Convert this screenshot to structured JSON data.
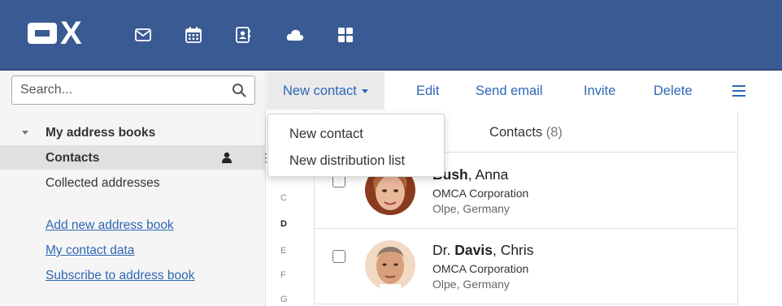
{
  "brand": {
    "logo_text": "OX",
    "topbar_color": "#3a5a93",
    "accent": "#2e67b5"
  },
  "apps": [
    {
      "name": "mail-icon"
    },
    {
      "name": "calendar-icon"
    },
    {
      "name": "address-book-icon"
    },
    {
      "name": "cloud-icon"
    },
    {
      "name": "portal-grid-icon"
    }
  ],
  "search": {
    "placeholder": "Search..."
  },
  "sidebar": {
    "section_title": "My address books",
    "folders": [
      {
        "label": "Contacts",
        "selected": true
      },
      {
        "label": "Collected addresses",
        "selected": false
      }
    ],
    "links": [
      "Add new address book",
      "My contact data",
      "Subscribe to address book"
    ]
  },
  "toolbar": {
    "new_contact": "New contact",
    "edit": "Edit",
    "send_email": "Send email",
    "invite": "Invite",
    "delete": "Delete"
  },
  "dropdown": {
    "items": [
      "New contact",
      "New distribution list"
    ]
  },
  "index_letters": [
    {
      "letter": "C",
      "active": false
    },
    {
      "letter": "D",
      "active": true
    },
    {
      "letter": "E",
      "active": false
    },
    {
      "letter": "F",
      "active": false
    },
    {
      "letter": "G",
      "active": false
    }
  ],
  "list": {
    "title": "Contacts",
    "count": "(8)",
    "contacts": [
      {
        "prefix": "",
        "last": "Bush",
        "first": "Anna",
        "company": "OMCA Corporation",
        "location": "Olpe, Germany"
      },
      {
        "prefix": "Dr.",
        "last": "Davis",
        "first": "Chris",
        "company": "OMCA Corporation",
        "location": "Olpe, Germany"
      }
    ]
  }
}
